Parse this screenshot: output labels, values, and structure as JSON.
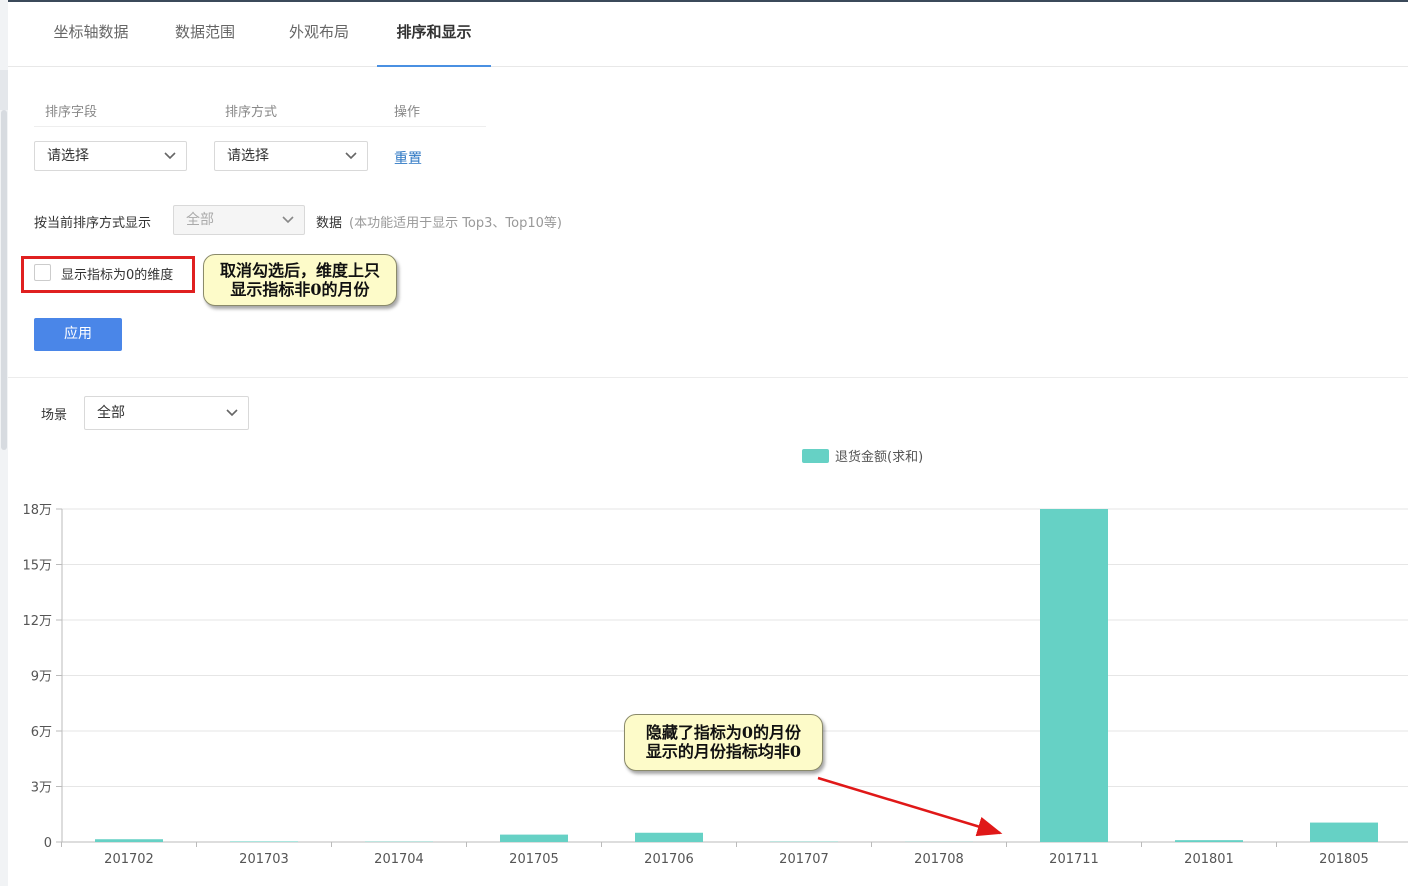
{
  "tabs": [
    "坐标轴数据",
    "数据范围",
    "外观布局",
    "排序和显示"
  ],
  "active_tab": "排序和显示",
  "sort": {
    "header_field": "排序字段",
    "header_method": "排序方式",
    "header_action": "操作",
    "field_placeholder": "请选择",
    "method_placeholder": "请选择",
    "reset": "重置"
  },
  "display": {
    "label": "按当前排序方式显示",
    "select_value": "全部",
    "suffix": "数据",
    "hint": "(本功能适用于显示 Top3、Top10等)"
  },
  "checkbox": {
    "label": "显示指标为0的维度",
    "checked": false
  },
  "callout1": {
    "line1": "取消勾选后，维度上只",
    "line2": "显示指标非0的月份"
  },
  "apply": "应用",
  "scene": {
    "label": "场景",
    "value": "全部"
  },
  "callout2": {
    "line1": "隐藏了指标为0的月份",
    "line2": "显示的月份指标均非0"
  },
  "colors": {
    "bar": "#66d1c5",
    "accent": "#4a86e8",
    "highlight": "#e02020"
  },
  "chart_data": {
    "type": "bar",
    "categories": [
      "201702",
      "201703",
      "201704",
      "201705",
      "201706",
      "201707",
      "201708",
      "201711",
      "201801",
      "201805"
    ],
    "series": [
      {
        "name": "退货金额(求和)",
        "values": [
          1500,
          300,
          200,
          4000,
          5000,
          200,
          100,
          180000,
          1000,
          10500
        ]
      }
    ],
    "yticks": [
      "0",
      "3万",
      "6万",
      "9万",
      "12万",
      "15万",
      "18万"
    ],
    "ylim": [
      0,
      180000
    ],
    "grid": true,
    "legend": "top"
  }
}
